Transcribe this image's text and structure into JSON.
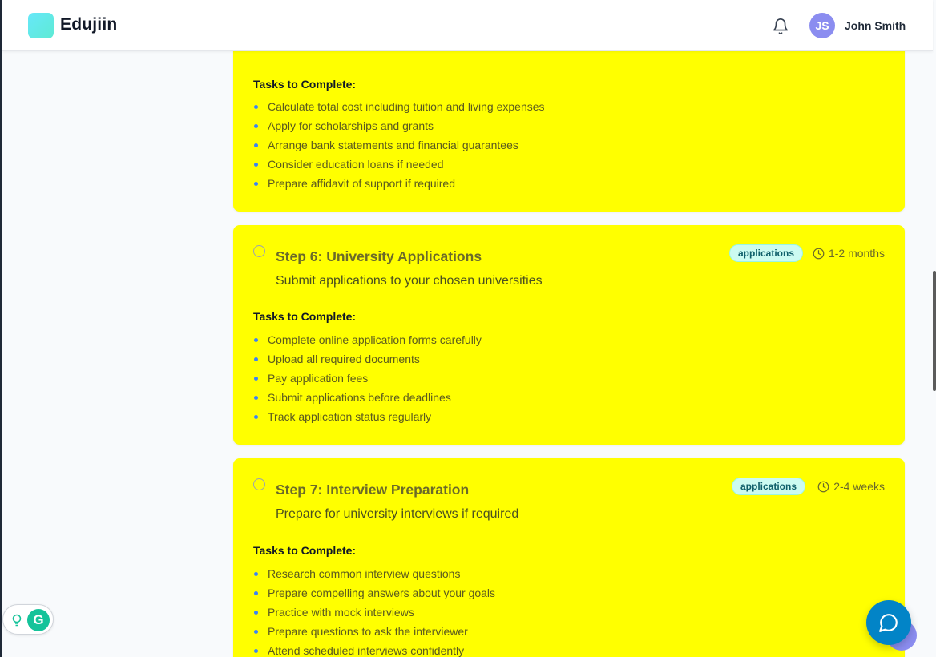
{
  "app": {
    "name": "Edujiin"
  },
  "user": {
    "initials": "JS",
    "name": "John Smith"
  },
  "prev_card": {
    "tasks_label": "Tasks to Complete:",
    "tasks": [
      "Calculate total cost including tuition and living expenses",
      "Apply for scholarships and grants",
      "Arrange bank statements and financial guarantees",
      "Consider education loans if needed",
      "Prepare affidavit of support if required"
    ]
  },
  "steps": [
    {
      "title": "Step 6: University Applications",
      "description": "Submit applications to your chosen universities",
      "category": "applications",
      "duration": "1-2 months",
      "tasks_label": "Tasks to Complete:",
      "tasks": [
        "Complete online application forms carefully",
        "Upload all required documents",
        "Pay application fees",
        "Submit applications before deadlines",
        "Track application status regularly"
      ]
    },
    {
      "title": "Step 7: Interview Preparation",
      "description": "Prepare for university interviews if required",
      "category": "applications",
      "duration": "2-4 weeks",
      "tasks_label": "Tasks to Complete:",
      "tasks": [
        "Research common interview questions",
        "Prepare compelling answers about your goals",
        "Practice with mock interviews",
        "Prepare questions to ask the interviewer",
        "Attend scheduled interviews confidently"
      ]
    }
  ],
  "icons": {
    "bell": "bell-icon",
    "clock": "clock-icon",
    "chat": "chat-bubble-icon",
    "grammarly": "grammarly-icon",
    "bulb": "lightbulb-icon"
  },
  "colors": {
    "card_bg": "#ffff00",
    "badge_bg": "#ccfbf1",
    "bullet": "#3b82f6",
    "chat_fab": "#0284c7",
    "avatar": "#8b8df0"
  }
}
